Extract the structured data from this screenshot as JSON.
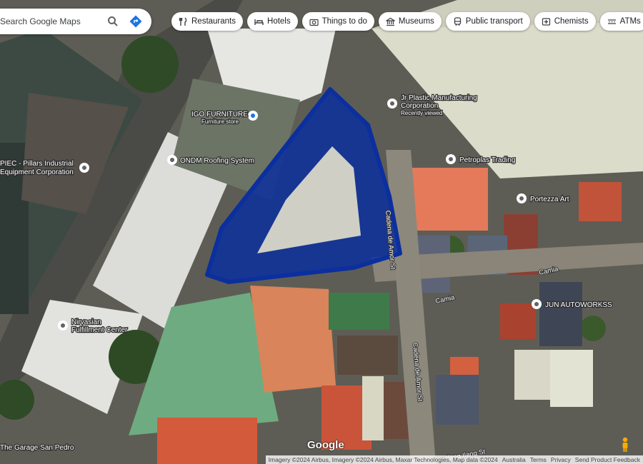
{
  "search": {
    "placeholder": "Search Google Maps"
  },
  "chips": [
    {
      "label": "Restaurants",
      "icon": "fork-knife-icon"
    },
    {
      "label": "Hotels",
      "icon": "bed-icon"
    },
    {
      "label": "Things to do",
      "icon": "camera-icon"
    },
    {
      "label": "Museums",
      "icon": "museum-icon"
    },
    {
      "label": "Public transport",
      "icon": "train-icon"
    },
    {
      "label": "Chemists",
      "icon": "pharmacy-icon"
    },
    {
      "label": "ATMs",
      "icon": "atm-icon"
    }
  ],
  "places": [
    {
      "name": "PIEC - Pillars Industrial"
    },
    {
      "name": "Equipment Corporation"
    },
    {
      "name": "IGO FURNITURE"
    },
    {
      "name": "Furniture store"
    },
    {
      "name": "ONDM Roofing System"
    },
    {
      "name": "Jr Plastic Manufacturing"
    },
    {
      "name": "Corporation"
    },
    {
      "name": "Recently viewed"
    },
    {
      "name": "Petroplas Trading"
    },
    {
      "name": "Portezza Art"
    },
    {
      "name": "JUN AUTOWORKSS"
    },
    {
      "name": "Nirvasian"
    },
    {
      "name": "Fulfillment Center"
    },
    {
      "name": "The Garage San Pedro"
    }
  ],
  "streets": [
    {
      "name": "Cadena de Amor St"
    },
    {
      "name": "Camia"
    },
    {
      "name": "Camia"
    },
    {
      "name": "Cadena de Amor St"
    },
    {
      "name": "Ilang Ilang St"
    }
  ],
  "highlight": {
    "color": "#0b2f9e"
  },
  "footer": {
    "logo": "Google",
    "attribution": "Imagery ©2024 Airbus, Imagery ©2024 Airbus, Maxar Technologies, Map data ©2024",
    "country": "Australia",
    "terms": "Terms",
    "privacy": "Privacy",
    "feedback": "Send Product Feedback"
  }
}
